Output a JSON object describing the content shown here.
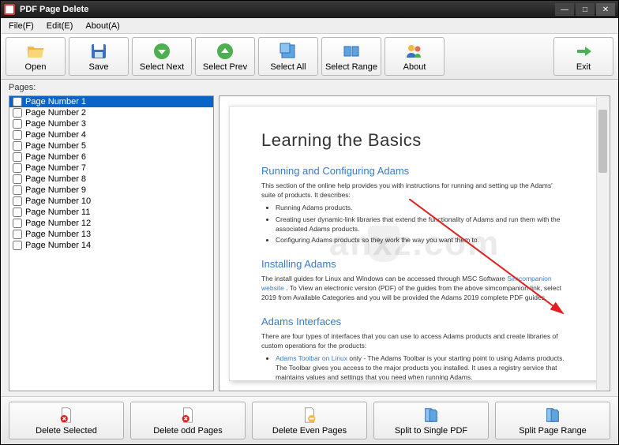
{
  "window": {
    "title": "PDF Page Delete"
  },
  "menu": {
    "file": "File(F)",
    "edit": "Edit(E)",
    "about": "About(A)"
  },
  "toolbar": {
    "open": "Open",
    "save": "Save",
    "select_next": "Select Next",
    "select_prev": "Select Prev",
    "select_all": "Select All",
    "select_range": "Select Range",
    "about": "About",
    "exit": "Exit"
  },
  "pages_label": "Pages:",
  "pages": [
    "Page Number 1",
    "Page Number 2",
    "Page Number 3",
    "Page Number 4",
    "Page Number 5",
    "Page Number 6",
    "Page Number 7",
    "Page Number 8",
    "Page Number 9",
    "Page Number 10",
    "Page Number 11",
    "Page Number 12",
    "Page Number 13",
    "Page Number 14"
  ],
  "selected_page_index": 0,
  "preview": {
    "title": "Learning the Basics",
    "h_running": "Running and Configuring Adams",
    "p_running": "This section of the online help provides you with instructions for running and setting up the Adams' suite of products. It describes:",
    "li_r1": "Running Adams products.",
    "li_r2": "Creating user dynamic-link libraries that extend the functionality of Adams and run them with the associated Adams products.",
    "li_r3": "Configuring Adams products so they work the way you want them to.",
    "h_install": "Installing Adams",
    "p_install1": "The install guides for Linux and Windows can be accessed through MSC Software ",
    "link_sim": "Simcompanion website",
    "p_install2": ". To View an electronic version (PDF) of the guides from the above simcompanion link, select 2019 from Available Categories and you will be provided the Adams 2019 complete PDF guides.",
    "h_interfaces": "Adams Interfaces",
    "p_interfaces": "There are four types of interfaces that you can use to access Adams products and create libraries of custom operations for the products:",
    "link_toolbar": "Adams Toolbar on Linux",
    "li_i1": " only - The Adams Toolbar is your starting point to using Adams products. The Toolbar gives you access to the major products you installed. It uses a registry service that maintains values and settings that you need when running Adams."
  },
  "watermark": "anxz.com",
  "bottom": {
    "delete_selected": "Delete Selected",
    "delete_odd": "Delete odd Pages",
    "delete_even": "Delete Even Pages",
    "split_single": "Split to Single PDF",
    "split_range": "Split Page Range"
  },
  "colors": {
    "accent": "#0a64c8",
    "link": "#3b7bbf"
  }
}
